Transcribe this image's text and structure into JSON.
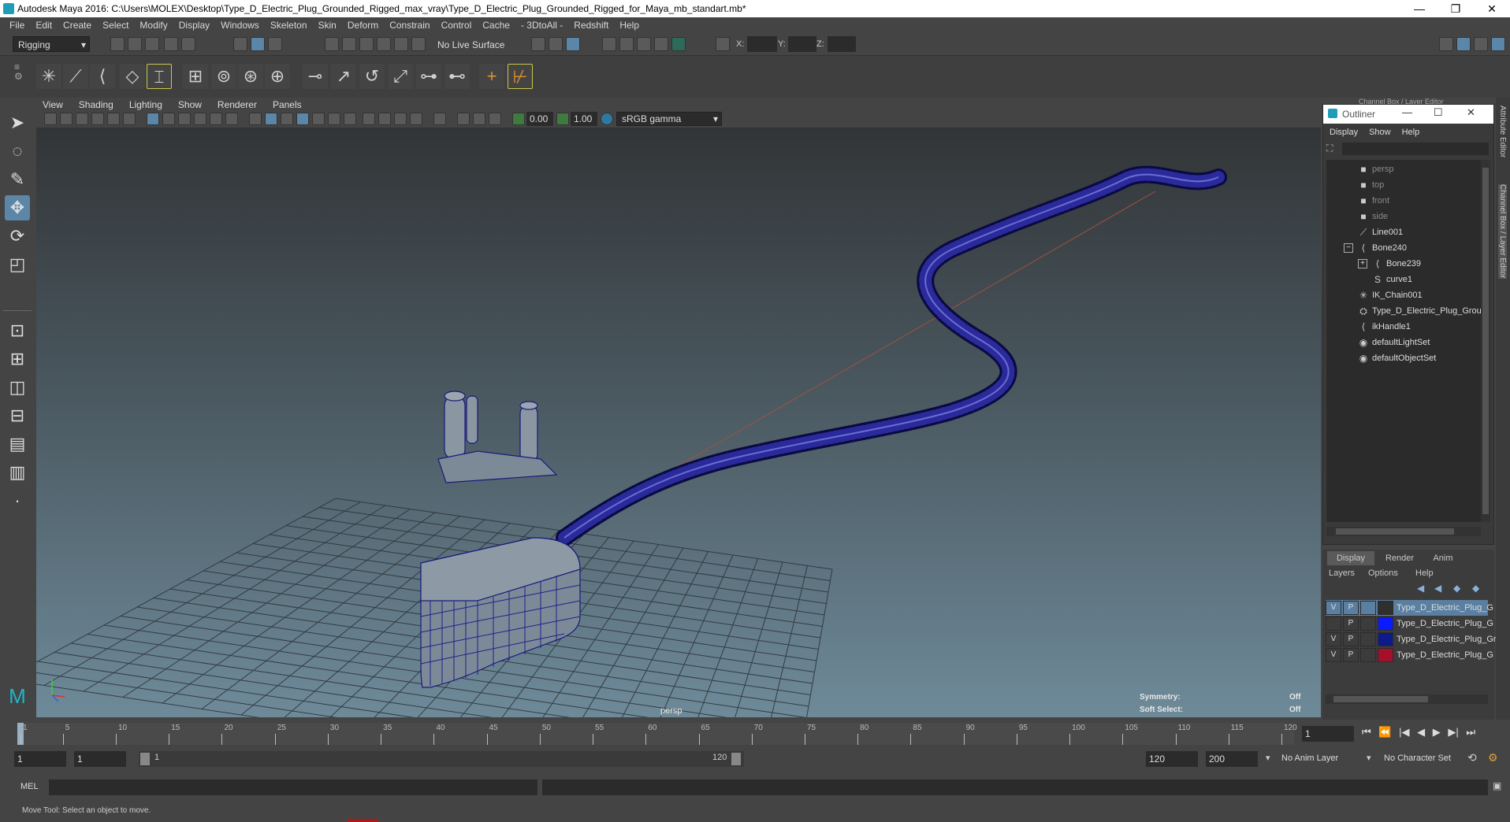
{
  "window": {
    "title": "Autodesk Maya 2016: C:\\Users\\MOLEX\\Desktop\\Type_D_Electric_Plug_Grounded_Rigged_max_vray\\Type_D_Electric_Plug_Grounded_Rigged_for_Maya_mb_standart.mb*",
    "minimize": "—",
    "restore": "❐",
    "close": "✕"
  },
  "menubar": [
    "File",
    "Edit",
    "Create",
    "Select",
    "Modify",
    "Display",
    "Windows",
    "Skeleton",
    "Skin",
    "Deform",
    "Constrain",
    "Control",
    "Cache",
    "- 3DtoAll -",
    "Redshift",
    "Help"
  ],
  "statusline": {
    "mode": "Rigging",
    "live_surface": "No Live Surface",
    "x_label": "X:",
    "y_label": "Y:",
    "z_label": "Z:"
  },
  "panel": {
    "menus": [
      "View",
      "Shading",
      "Lighting",
      "Show",
      "Renderer",
      "Panels"
    ],
    "field_a": "0.00",
    "field_b": "1.00",
    "color_space": "sRGB gamma",
    "camera_label": "persp",
    "symmetry_label": "Symmetry:",
    "symmetry_value": "Off",
    "soft_select_label": "Soft Select:",
    "soft_select_value": "Off"
  },
  "right_panel": {
    "header_label": "Channel Box / Layer Editor"
  },
  "outliner": {
    "title": "Outliner",
    "menus": [
      "Display",
      "Show",
      "Help"
    ],
    "items": [
      {
        "label": "persp",
        "icon": "camera-icon",
        "indent": 1,
        "muted": true
      },
      {
        "label": "top",
        "icon": "camera-icon",
        "indent": 1,
        "muted": true
      },
      {
        "label": "front",
        "icon": "camera-icon",
        "indent": 1,
        "muted": true
      },
      {
        "label": "side",
        "icon": "camera-icon",
        "indent": 1,
        "muted": true
      },
      {
        "label": "Line001",
        "icon": "curve-icon",
        "indent": 1,
        "muted": false
      },
      {
        "label": "Bone240",
        "icon": "joint-icon",
        "indent": 1,
        "muted": false,
        "expander": "−"
      },
      {
        "label": "Bone239",
        "icon": "joint-icon",
        "indent": 2,
        "muted": false,
        "expander": "+"
      },
      {
        "label": "curve1",
        "icon": "nurbs-curve-icon",
        "indent": 2,
        "muted": false
      },
      {
        "label": "IK_Chain001",
        "icon": "ik-chain-icon",
        "indent": 1,
        "muted": false
      },
      {
        "label": "Type_D_Electric_Plug_Grou",
        "icon": "mesh-group-icon",
        "indent": 1,
        "muted": false
      },
      {
        "label": "ikHandle1",
        "icon": "ik-handle-icon",
        "indent": 1,
        "muted": false
      },
      {
        "label": "defaultLightSet",
        "icon": "set-icon",
        "indent": 1,
        "muted": false
      },
      {
        "label": "defaultObjectSet",
        "icon": "set-icon",
        "indent": 1,
        "muted": false
      }
    ]
  },
  "layer_editor": {
    "tabs": [
      "Display",
      "Render",
      "Anim"
    ],
    "menus": [
      "Layers",
      "Options",
      "Help"
    ],
    "layers": [
      {
        "v": "V",
        "p": "P",
        "color": "#2f2f2f",
        "name": "Type_D_Electric_Plug_G",
        "selected": true
      },
      {
        "v": "",
        "p": "P",
        "color": "#0a1cff",
        "name": "Type_D_Electric_Plug_G",
        "selected": false
      },
      {
        "v": "V",
        "p": "P",
        "color": "#0d1a8a",
        "name": "Type_D_Electric_Plug_Gro",
        "selected": false
      },
      {
        "v": "V",
        "p": "P",
        "color": "#a3102a",
        "name": "Type_D_Electric_Plug_G",
        "selected": false
      }
    ]
  },
  "side_tabs": [
    "Attribute Editor",
    "Channel Box / Layer Editor"
  ],
  "timeline": {
    "ticks": [
      "1",
      "5",
      "10",
      "15",
      "20",
      "25",
      "30",
      "35",
      "40",
      "45",
      "50",
      "55",
      "60",
      "65",
      "70",
      "75",
      "80",
      "85",
      "90",
      "95",
      "100",
      "105",
      "110",
      "115",
      "120"
    ],
    "current_frame": "1",
    "range_start": "1",
    "range_start2": "1",
    "slider_start": "1",
    "slider_end": "120",
    "range_end": "120",
    "range_end2": "200",
    "anim_layer": "No Anim Layer",
    "character_set": "No Character Set"
  },
  "cmdline": {
    "language": "MEL"
  },
  "helpline": {
    "text": "Move Tool: Select an object to move."
  }
}
